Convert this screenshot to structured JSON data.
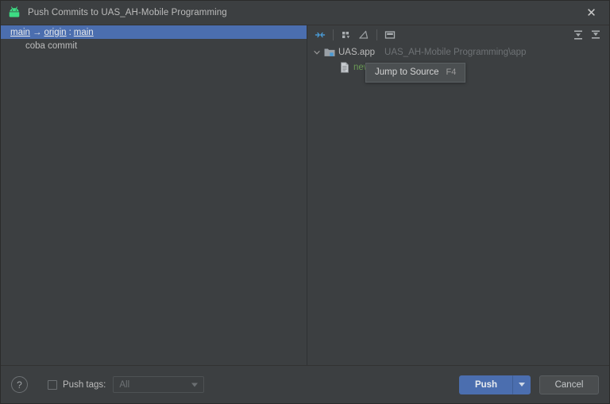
{
  "window": {
    "title": "Push Commits to UAS_AH-Mobile Programming",
    "app_icon": "android-robot-icon",
    "close_label": "✕"
  },
  "commits": {
    "branch_row": {
      "source": "main",
      "arrow": "→",
      "remote": "origin",
      "separator": ":",
      "target": "main"
    },
    "items": [
      {
        "message": "coba commit"
      }
    ]
  },
  "toolbar": {
    "buttons": [
      {
        "name": "show-diff-icon",
        "title": "Show Diff"
      },
      {
        "name": "group-by-icon",
        "title": "Group By"
      },
      {
        "name": "edit-source-icon",
        "title": "Edit Source"
      },
      {
        "name": "preview-diff-icon",
        "title": "Preview Diff"
      },
      {
        "name": "expand-all-icon",
        "title": "Expand All"
      },
      {
        "name": "collapse-all-icon",
        "title": "Collapse All"
      }
    ]
  },
  "tooltip": {
    "label": "Jump to Source",
    "shortcut": "F4"
  },
  "tree": {
    "nodes": [
      {
        "label": "UAS.app",
        "path": "UAS_AH-Mobile Programming\\app",
        "icon": "module-folder-icon",
        "expanded": true,
        "chevron": "⌄"
      },
      {
        "label": "newfl.txt",
        "icon": "file-icon",
        "color": "#6a9a55"
      }
    ]
  },
  "footer": {
    "help_label": "?",
    "push_tags_label": "Push tags:",
    "push_tags_checked": false,
    "tags_value": "All",
    "push_label": "Push",
    "cancel_label": "Cancel"
  },
  "colors": {
    "background": "#3c3f41",
    "selection": "#4b6eaf",
    "accent": "#4b6eaf",
    "added_file": "#6a9a55",
    "text": "#bbbbbb",
    "muted_text": "#6e7275",
    "tooltip_bg": "#4b4f51"
  }
}
